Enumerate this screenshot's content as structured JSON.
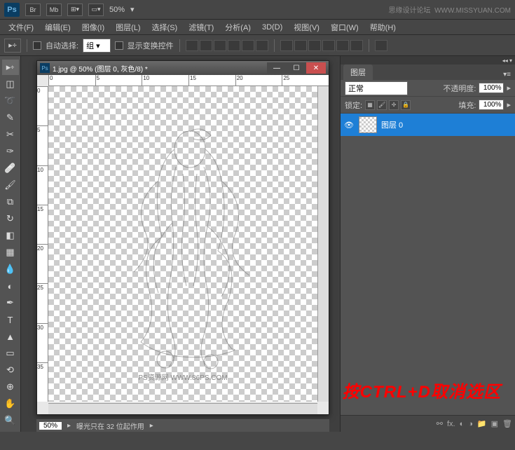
{
  "topbar": {
    "ps_label": "Ps",
    "br_label": "Br",
    "mb_label": "Mb",
    "zoom": "50%",
    "watermark_site": "思缘设计论坛",
    "watermark_url": "WWW.MISSYUAN.COM"
  },
  "menus": [
    "文件(F)",
    "编辑(E)",
    "图像(I)",
    "图层(L)",
    "选择(S)",
    "滤镜(T)",
    "分析(A)",
    "3D(D)",
    "视图(V)",
    "窗口(W)",
    "帮助(H)"
  ],
  "options": {
    "auto_select": "自动选择:",
    "group": "组",
    "show_transform": "显示变换控件"
  },
  "document": {
    "title": "1.jpg @ 50% (图层 0, 灰色/8) *",
    "ruler_h": [
      "0",
      "5",
      "10",
      "15",
      "20",
      "25"
    ],
    "ruler_v": [
      "0",
      "5",
      "10",
      "15",
      "20",
      "25",
      "30",
      "35"
    ],
    "canvas_watermark": "PS资源网  WWW.86PS.COM"
  },
  "status": {
    "zoom": "50%",
    "info": "曝光只在 32 位起作用"
  },
  "layers_panel": {
    "tab": "图层",
    "blend_mode": "正常",
    "opacity_label": "不透明度:",
    "opacity_value": "100%",
    "lock_label": "锁定:",
    "fill_label": "填充:",
    "fill_value": "100%",
    "layer_name": "图层 0"
  },
  "annotation": "按CTRL+D取消选区"
}
